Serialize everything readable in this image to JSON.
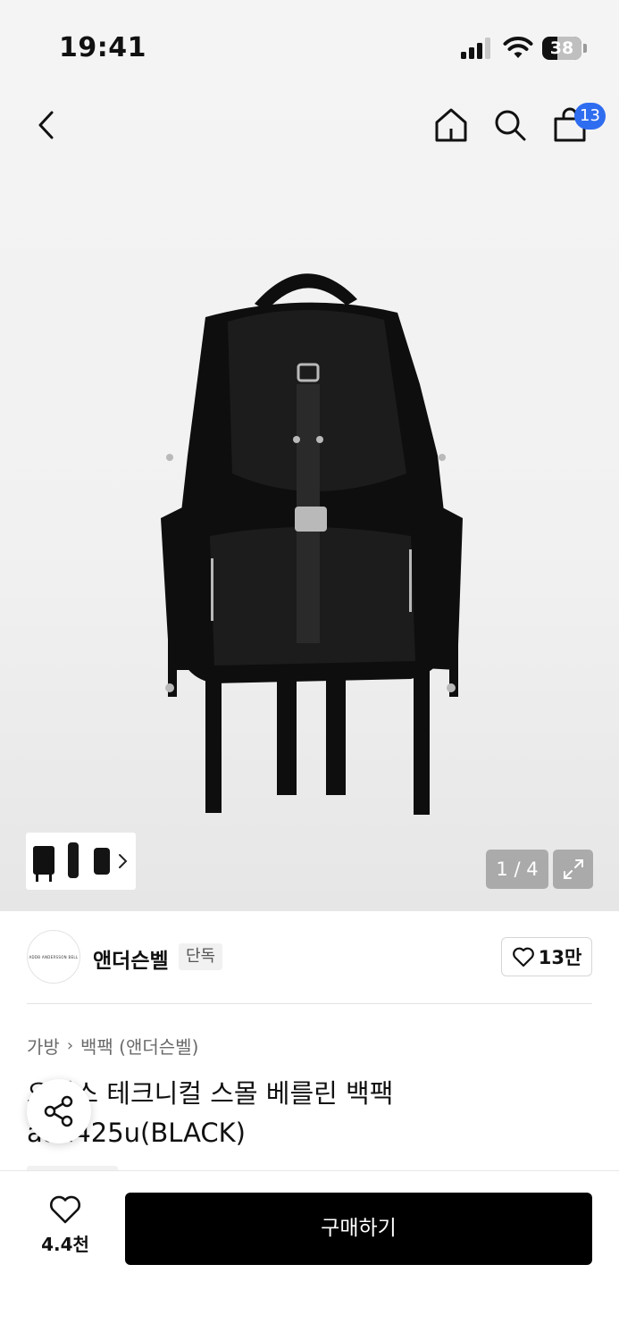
{
  "status_bar": {
    "time": "19:41",
    "battery_level": "38",
    "battery_fraction": 0.38
  },
  "nav": {
    "back_icon": "chevron-left-icon",
    "home_icon": "home-icon",
    "search_icon": "search-icon",
    "cart_icon": "shopping-bag-icon",
    "cart_count": "13"
  },
  "gallery": {
    "current_page": "1 / 4",
    "expand_icon": "expand-icon",
    "thumbnail_arrow_icon": "chevron-right-icon"
  },
  "brand": {
    "logo_text": "ADDB ANDERSSON BELL",
    "name": "앤더슨벨",
    "tag": "단독",
    "like_label": "13만"
  },
  "breadcrumb": [
    "가방",
    "백팩 (앤더슨벨)"
  ],
  "product": {
    "title": "오닉스 테크니컬 스몰 베를린 백팩 aaa425u(BLACK)"
  },
  "share": {
    "icon": "share-icon"
  },
  "bottom_bar": {
    "wish_count": "4.4천",
    "buy_label": "구매하기"
  },
  "colors": {
    "accent_blue": "#2f6df0",
    "buy_button": "#000000",
    "product": "#0e0e0e"
  }
}
